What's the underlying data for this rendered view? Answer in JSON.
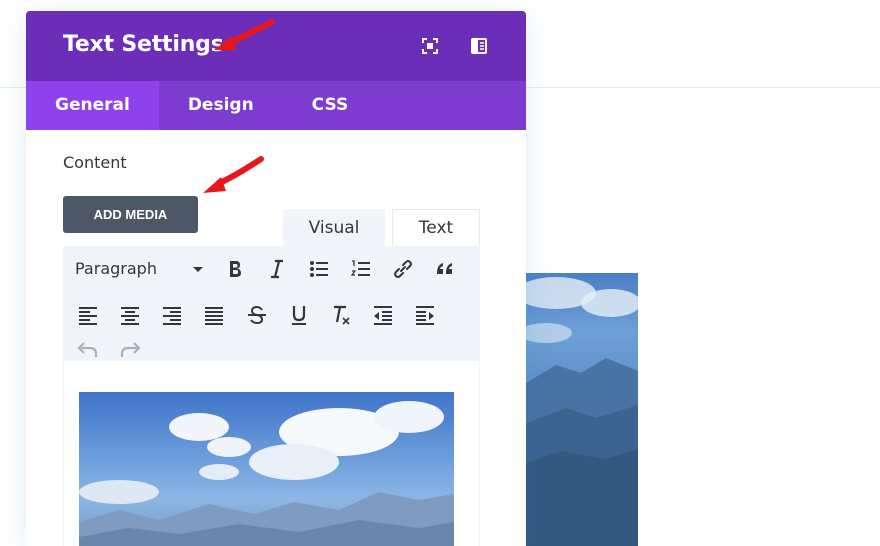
{
  "modal": {
    "title": "Text Settings",
    "header_icons": [
      "expand-icon",
      "split-view-icon"
    ],
    "tabs": [
      {
        "label": "General",
        "active": true
      },
      {
        "label": "Design",
        "active": false
      },
      {
        "label": "CSS",
        "active": false
      }
    ]
  },
  "content": {
    "section_label": "Content",
    "add_media_label": "ADD MEDIA",
    "editor_tabs": [
      {
        "label": "Visual",
        "active": true
      },
      {
        "label": "Text",
        "active": false
      }
    ],
    "format_select": "Paragraph",
    "toolbar_icons_row1": [
      "bold-icon",
      "italic-icon",
      "bullet-list-icon",
      "numbered-list-icon",
      "link-icon",
      "blockquote-icon"
    ],
    "toolbar_icons_row2": [
      "align-left-icon",
      "align-center-icon",
      "align-right-icon",
      "align-justify-icon",
      "strikethrough-icon",
      "underline-icon",
      "clear-formatting-icon",
      "outdent-icon",
      "indent-icon"
    ],
    "toolbar_icons_row3": [
      "undo-icon",
      "redo-icon"
    ]
  },
  "colors": {
    "header": "#6c2eb9",
    "tabs_bar": "#7e3bd0",
    "active_tab": "#8f42ec",
    "button": "#4c5866",
    "toolbar_bg": "#f1f5f9",
    "annotation_arrow": "#e8171c"
  }
}
